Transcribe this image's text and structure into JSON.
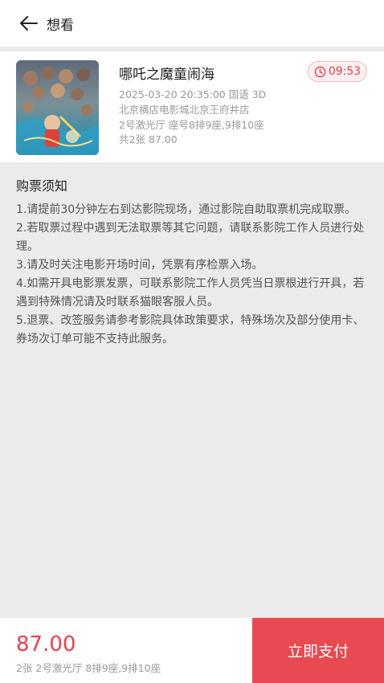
{
  "header": {
    "title": "想看"
  },
  "order": {
    "movie_title": "哪吒之魔童闹海",
    "countdown": "09:53",
    "showtime_lang": "2025-03-20 20:35:00 国语 3D",
    "cinema": "北京横店电影城北京王府井店",
    "hall_seats": "2号激光厅 座号8排9座,9排10座",
    "ticket_total": "共2张 87.00"
  },
  "notice": {
    "title": "购票须知",
    "items": [
      "1.请提前30分钟左右到达影院现场，通过影院自助取票机完成取票。",
      " 2.若取票过程中遇到无法取票等其它问题，请联系影院工作人员进行处理。",
      " 3.请及时关注电影开场时间，凭票有序检票入场。",
      " 4.如需开具电影票发票，可联系影院工作人员凭当日票根进行开具，若遇到特殊情况请及时联系猫眼客服人员。",
      " 5.退票、改签服务请参考影院具体政策要求，特殊场次及部分使用卡、券场次订单可能不支持此服务。"
    ]
  },
  "bottom": {
    "price": "87.00",
    "summary": "2张 2号激光厅 8排9座,9排10座",
    "pay_label": "立即支付"
  },
  "colors": {
    "accent": "#e94a52",
    "background": "#ebebeb"
  },
  "icons": {
    "back": "arrow-left-icon",
    "timer": "clock-icon",
    "poster": "movie-poster-image"
  }
}
